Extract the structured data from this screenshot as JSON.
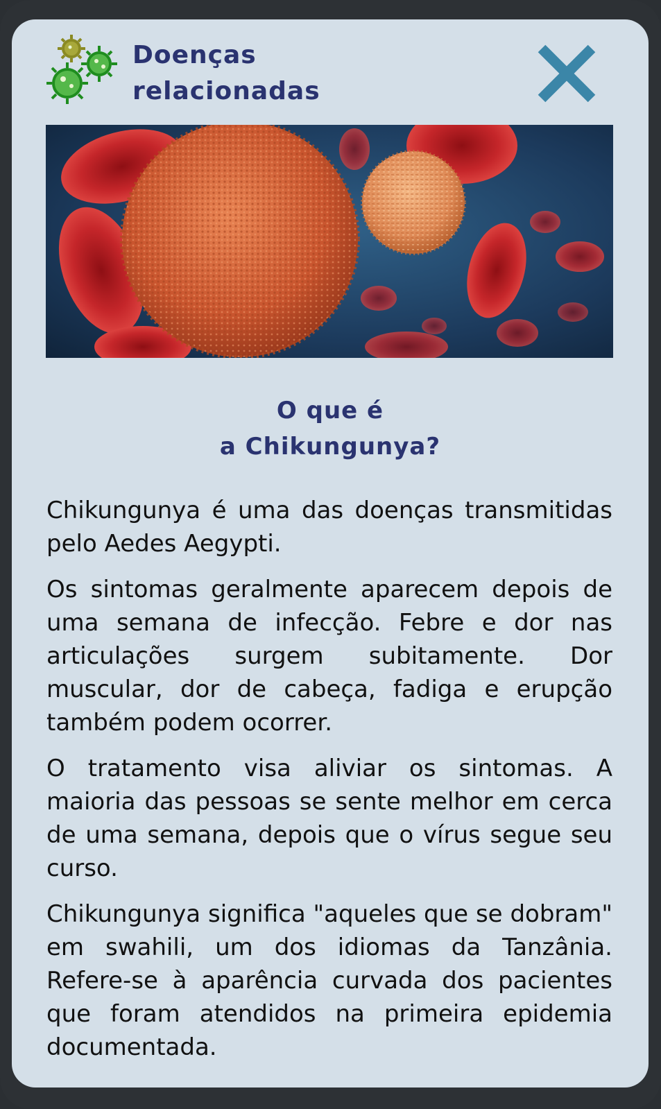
{
  "header": {
    "title_line1": "Doenças",
    "title_line2": "relacionadas",
    "logo_icon": "virus-cluster-icon",
    "close_icon": "close-x-icon"
  },
  "hero_image": {
    "description_icon": "virus-blood-cells-image"
  },
  "section": {
    "title_line1": "O que é",
    "title_line2": "a Chikungunya?"
  },
  "paragraphs": [
    "Chikungunya é uma das doenças transmitidas pelo Aedes Aegypti.",
    "Os sintomas geralmente aparecem depois de uma semana de infecção. Febre e dor nas articulações surgem subitamente. Dor muscular, dor de cabeça, fadiga e erupção também podem ocorrer.",
    "O tratamento visa aliviar os sintomas. A maioria das pessoas se sente melhor em cerca de uma semana, depois que o vírus segue seu curso.",
    "Chikungunya significa \"aqueles que se dobram\" em swahili, um dos idiomas da Tanzânia. Refere-se à aparência curvada dos pacientes que foram atendidos na primeira epidemia documentada."
  ],
  "colors": {
    "frame": "#2d3135",
    "card": "#d4dfe8",
    "title": "#2a3370",
    "close": "#3b86a8",
    "virus_green": "#2e9a2a",
    "virus_olive": "#8f8f28"
  }
}
